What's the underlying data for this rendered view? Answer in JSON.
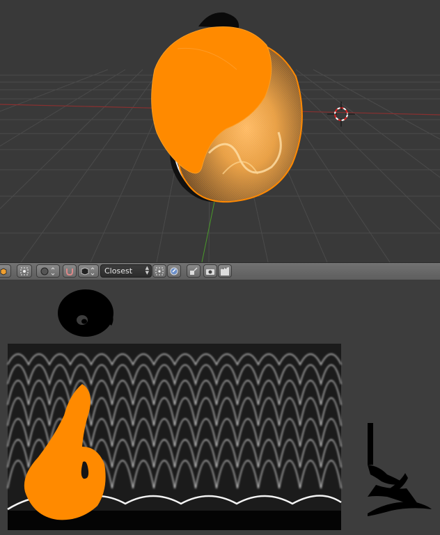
{
  "toolbar": {
    "snap_target": "Closest"
  },
  "icons": [
    "object-mode-icon",
    "pivot-point-icon",
    "viewport-shading-icon",
    "snap-magnet-icon",
    "snap-element-icon",
    "snap-target-icon",
    "snap-rotation-icon",
    "proportional-edit-icon",
    "render-camera-icon",
    "render-animation-icon"
  ],
  "colors": {
    "viewport_bg": "#393939",
    "grid_line": "#4a4a4a",
    "x_axis": "#8c3232",
    "y_axis": "#4c8c2c",
    "selection_orange": "#ff8800",
    "header_bg": "#6a6a6a",
    "panel_bg": "#3d3d3d"
  }
}
